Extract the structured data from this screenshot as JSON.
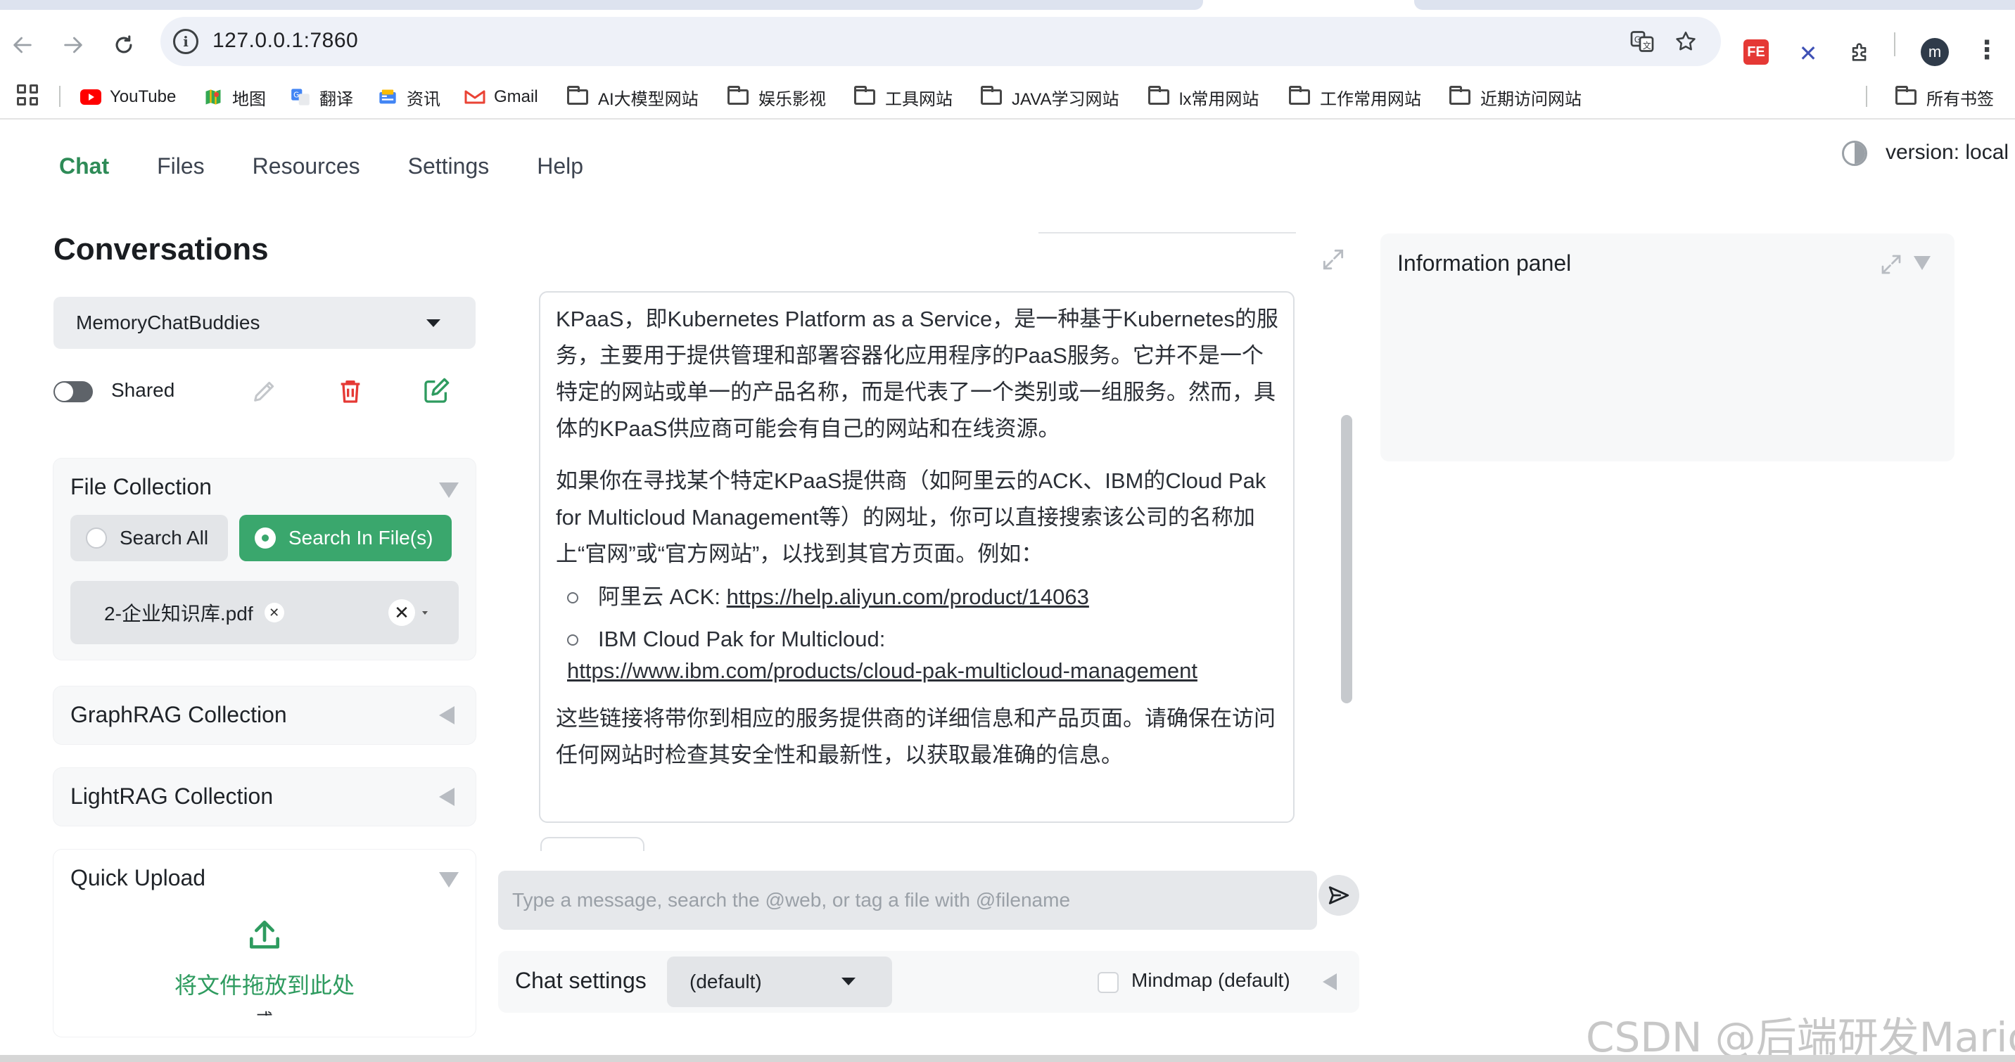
{
  "browser": {
    "url": "127.0.0.1:7860",
    "bookmarks": [
      {
        "label": "YouTube",
        "icon": "youtube-icon"
      },
      {
        "label": "地图",
        "icon": "maps-icon"
      },
      {
        "label": "翻译",
        "icon": "translate-icon"
      },
      {
        "label": "资讯",
        "icon": "news-icon"
      },
      {
        "label": "Gmail",
        "icon": "gmail-icon"
      },
      {
        "label": "AI大模型网站",
        "icon": "folder-icon"
      },
      {
        "label": "娱乐影视",
        "icon": "folder-icon"
      },
      {
        "label": "工具网站",
        "icon": "folder-icon"
      },
      {
        "label": "JAVA学习网站",
        "icon": "folder-icon"
      },
      {
        "label": "lx常用网站",
        "icon": "folder-icon"
      },
      {
        "label": "工作常用网站",
        "icon": "folder-icon"
      },
      {
        "label": "近期访问网站",
        "icon": "folder-icon"
      }
    ],
    "all_bookmarks": "所有书签",
    "profile_initial": "m",
    "extension_fe": "FE"
  },
  "nav": {
    "tabs": [
      "Chat",
      "Files",
      "Resources",
      "Settings",
      "Help"
    ],
    "active": "Chat",
    "version": "version: local"
  },
  "sidebar": {
    "title": "Conversations",
    "conversation": "MemoryChatBuddies",
    "shared_label": "Shared",
    "file_collection": {
      "title": "File Collection",
      "options": [
        "Search All",
        "Search In File(s)"
      ],
      "selected": "Search In File(s)",
      "selected_file": "2-企业知识库.pdf"
    },
    "graphrag_title": "GraphRAG Collection",
    "lightrag_title": "LightRAG Collection",
    "quick_upload": {
      "title": "Quick Upload",
      "drop_text": "将文件拖放到此处",
      "or_text": "或"
    }
  },
  "chat": {
    "message": {
      "p1": "KPaaS，即Kubernetes Platform as a Service，是一种基于Kubernetes的服务，主要用于提供管理和部署容器化应用程序的PaaS服务。它并不是一个特定的网站或单一的产品名称，而是代表了一个类别或一组服务。然而，具体的KPaaS供应商可能会有自己的网站和在线资源。",
      "p2": "如果你在寻找某个特定KPaaS提供商（如阿里云的ACK、IBM的Cloud Pak for Multicloud Management等）的网址，你可以直接搜索该公司的名称加上“官网”或“官方网站”，以找到其官方页面。例如：",
      "item1_label": "阿里云 ACK: ",
      "item1_link": "https://help.aliyun.com/product/14063",
      "item2_label": "IBM Cloud Pak for Multicloud:",
      "item2_link": "https://www.ibm.com/products/cloud-pak-multicloud-management",
      "p3": "这些链接将带你到相应的服务提供商的详细信息和产品页面。请确保在访问任何网站时检查其安全性和最新性，以获取最准确的信息。"
    },
    "input_placeholder": "Type a message, search the @web, or tag a file with @filename",
    "settings_label": "Chat settings",
    "settings_value": "(default)",
    "mindmap_label": "Mindmap (default)"
  },
  "info_panel": {
    "title": "Information panel"
  },
  "watermark": "CSDN @后端研发Marion",
  "colors": {
    "accent": "#2e8b57",
    "primary_button": "#3aa76d",
    "delete": "#e53935",
    "new": "#2e9b5f"
  }
}
